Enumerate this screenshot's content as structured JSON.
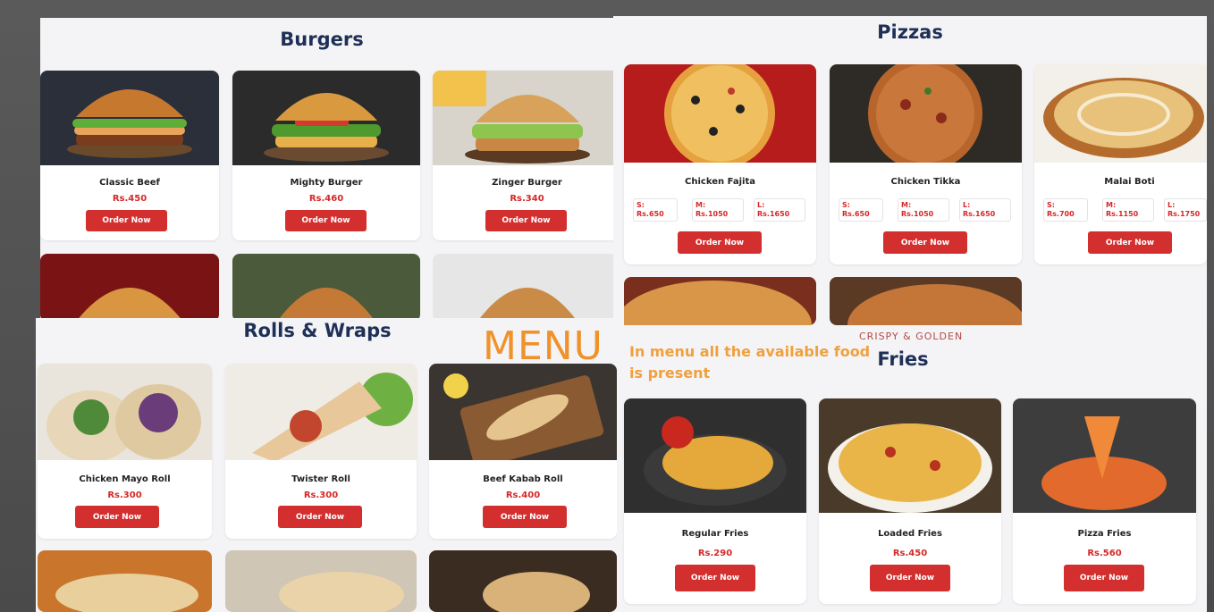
{
  "burgers": {
    "title": "Burgers",
    "items": [
      {
        "name": "Classic Beef",
        "price": "Rs.450"
      },
      {
        "name": "Mighty Burger",
        "price": "Rs.460"
      },
      {
        "name": "Zinger Burger",
        "price": "Rs.340"
      }
    ]
  },
  "pizzas": {
    "title": "Pizzas",
    "items": [
      {
        "name": "Chicken Fajita",
        "s": "S:\nRs.650",
        "m": "M:\nRs.1050",
        "l": "L:\nRs.1650"
      },
      {
        "name": "Chicken Tikka",
        "s": "S:\nRs.650",
        "m": "M:\nRs.1050",
        "l": "L:\nRs.1650"
      },
      {
        "name": "Malai Boti",
        "s": "S:\nRs.700",
        "m": "M:\nRs.1150",
        "l": "L:\nRs.1750"
      }
    ]
  },
  "rolls": {
    "title": "Rolls & Wraps",
    "items": [
      {
        "name": "Chicken Mayo Roll",
        "price": "Rs.300"
      },
      {
        "name": "Twister Roll",
        "price": "Rs.300"
      },
      {
        "name": "Beef Kabab Roll",
        "price": "Rs.400"
      }
    ]
  },
  "fries": {
    "eyebrow": "CRISPY & GOLDEN",
    "title": "Fries",
    "items": [
      {
        "name": "Regular Fries",
        "price": "Rs.290"
      },
      {
        "name": "Loaded Fries",
        "price": "Rs.450"
      },
      {
        "name": "Pizza Fries",
        "price": "Rs.560"
      }
    ]
  },
  "overlay": {
    "menu_word": "MENU",
    "description_line1": "In menu all the available food",
    "description_line2": "is present"
  },
  "order_label": "Order Now",
  "colors": {
    "accent": "#d32f2f",
    "title": "#1f3057",
    "overlay_text": "#f0922b"
  }
}
